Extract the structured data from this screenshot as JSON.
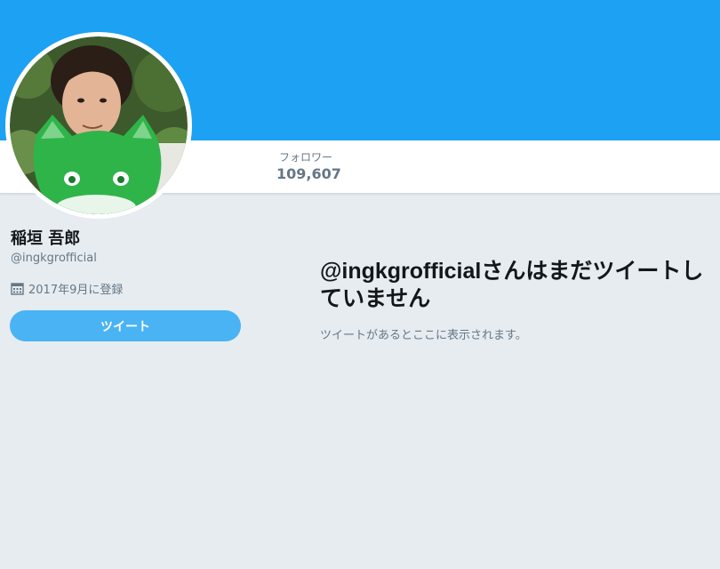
{
  "profile": {
    "name": "稲垣 吾郎",
    "handle": "@ingkgrofficial",
    "joined": "2017年9月に登録",
    "joined_icon": "calendar-icon",
    "avatar_icon": "profile-photo"
  },
  "nav": {
    "followers_label": "フォロワー",
    "followers_count": "109,607"
  },
  "actions": {
    "tweet_button": "ツイート"
  },
  "timeline": {
    "empty_title": "@ingkgrofficialさんはまだツイートしていません",
    "empty_subtitle": "ツイートがあるとここに表示されます。"
  },
  "colors": {
    "banner": "#1da1f2",
    "background": "#e6ecf0",
    "button": "#4ab3f4",
    "secondary_text": "#657786"
  }
}
